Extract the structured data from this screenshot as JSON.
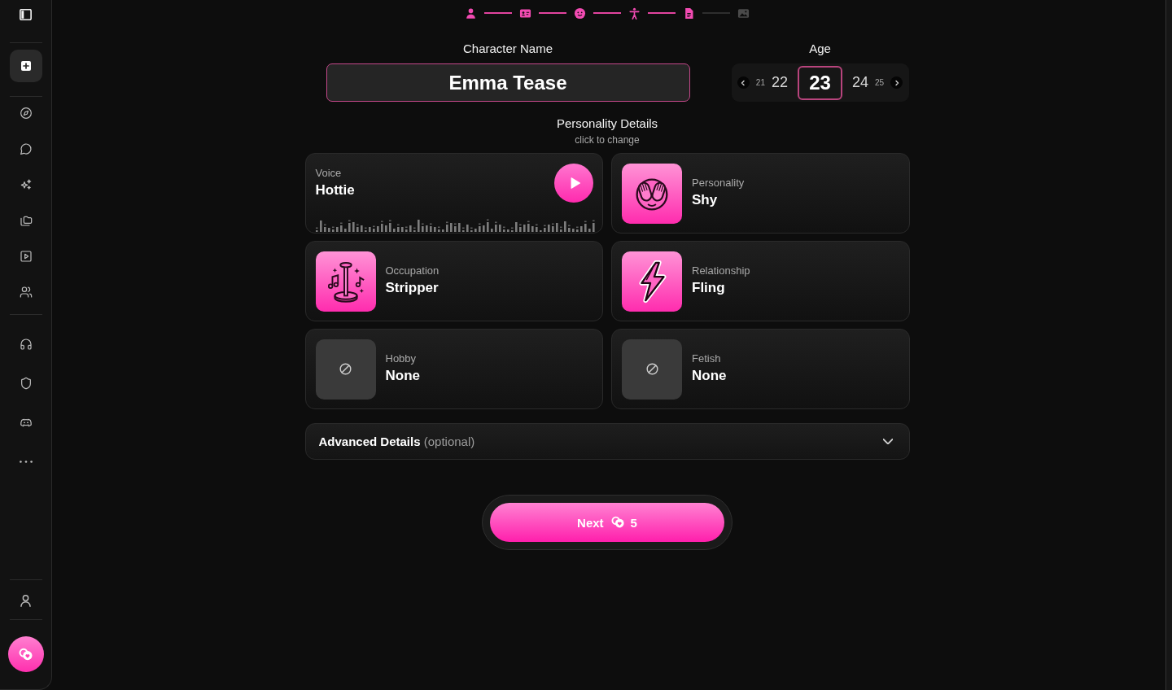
{
  "sidebar": {
    "sections": [
      {
        "items": [
          {
            "selected": true
          }
        ]
      },
      {
        "items": [
          {
            "selected": false
          },
          {
            "selected": false
          },
          {
            "selected": false
          },
          {
            "selected": false
          },
          {
            "selected": false
          },
          {
            "selected": false
          }
        ]
      },
      {
        "items": [
          {
            "selected": false
          },
          {
            "selected": false
          },
          {
            "selected": false
          },
          {
            "selected": false
          }
        ]
      }
    ]
  },
  "steps": [
    {
      "completed": true
    },
    {
      "completed": true
    },
    {
      "completed": true
    },
    {
      "completed": true
    },
    {
      "completed": true
    },
    {
      "completed": false
    }
  ],
  "character_name": {
    "label": "Character Name",
    "value": "Emma Tease"
  },
  "age": {
    "label": "Age",
    "options": [
      {
        "value": "21",
        "selected": false
      },
      {
        "value": "22",
        "selected": false
      },
      {
        "value": "23",
        "selected": true
      },
      {
        "value": "24",
        "selected": false
      },
      {
        "value": "25",
        "selected": false
      }
    ]
  },
  "personality_details": {
    "title": "Personality Details",
    "subtitle": "click to change"
  },
  "cards": [
    {
      "kind": "voice",
      "label": "Voice",
      "value": "Hottie"
    },
    {
      "kind": "picture",
      "label": "Personality",
      "value": "Shy"
    },
    {
      "kind": "picture",
      "label": "Occupation",
      "value": "Stripper"
    },
    {
      "kind": "picture",
      "label": "Relationship",
      "value": "Fling"
    },
    {
      "kind": "none",
      "label": "Hobby",
      "value": "None"
    },
    {
      "kind": "none",
      "label": "Fetish",
      "value": "None"
    }
  ],
  "advanced_details": {
    "text": "**Advanced Details** (optional)",
    "expanded": false
  },
  "next_button": {
    "label": "Next",
    "cost": "5"
  }
}
